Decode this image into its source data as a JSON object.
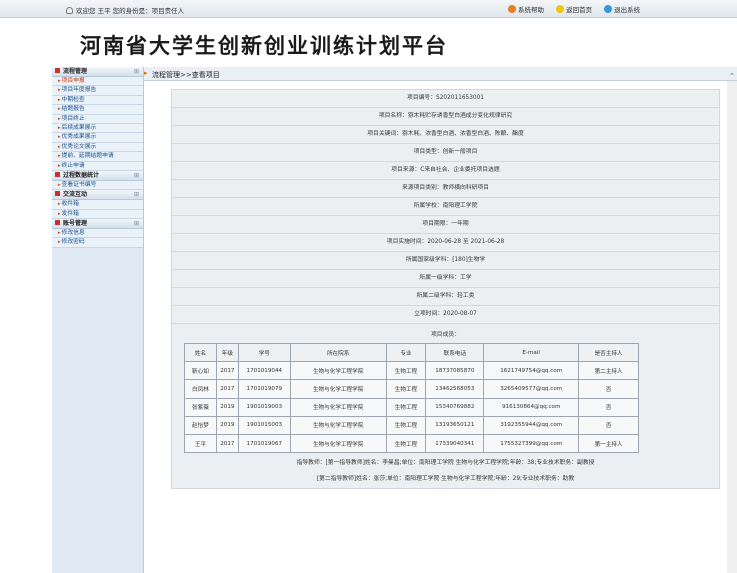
{
  "topbar": {
    "welcome": "欢迎您 王平 您的身份是：项目责任人",
    "links": [
      {
        "label": "系统帮助",
        "icon": "help-icon",
        "color": "#e67e22"
      },
      {
        "label": "返回首页",
        "icon": "home-icon",
        "color": "#f1c40f"
      },
      {
        "label": "退出系统",
        "icon": "logout-icon",
        "color": "#3498db"
      }
    ]
  },
  "banner": {
    "title": "河南省大学生创新创业训练计划平台"
  },
  "sidebar": {
    "groups": [
      {
        "title": "流程管理",
        "items": [
          "项目申报",
          "项目年度报告",
          "中期检查",
          "结题报告",
          "项目终止",
          "后续成果展示",
          "优秀成果展示",
          "优秀论文展示",
          "提前、延期结题申请",
          "终止申请"
        ]
      },
      {
        "title": "过程数据统计",
        "items": [
          "查看证书编号"
        ]
      },
      {
        "title": "交流互动",
        "items": [
          "收件箱",
          "发件箱"
        ]
      },
      {
        "title": "账号管理",
        "items": [
          "修改信息",
          "修改密码"
        ]
      }
    ]
  },
  "breadcrumb": "流程管理>>查看项目",
  "project": {
    "rows": [
      "项目编号：S202011653001",
      "项目名称：猕木耗贮存诱香型白酒成分变化规律研究",
      "项目关键词：猕木耗、浓香型白酒、浓香型白酒、陈酿、酯度",
      "项目类型：创新一般项目",
      "项目来源：C来自社会、企业委托项目选题",
      "来源项目类别：教师横向科研项目",
      "所属学校：南阳理工学院",
      "项目期限：一年期",
      "项目实施时间：2020-06-28 至 2021-06-28",
      "所属国家级学科：[180]生物学",
      "所属一级学科：工学",
      "所属二级学科：轻工类",
      "立项时间：2020-08-07"
    ],
    "members_title": "项目成员：",
    "member_headers": [
      "姓名",
      "年级",
      "学号",
      "所在院系",
      "专业",
      "联系电话",
      "E-mail",
      "是否主持人"
    ],
    "members": [
      [
        "靳心如",
        "2017",
        "1701019044",
        "生物与化学工程学院",
        "生物工程",
        "18737085870",
        "1621749754@qq.com",
        "第二主持人"
      ],
      [
        "白凤林",
        "2017",
        "1701019079",
        "生物与化学工程学院",
        "生物工程",
        "13462568053",
        "3265409577@qq.com",
        "否"
      ],
      [
        "张紫薇",
        "2019",
        "1901019003",
        "生物与化学工程学院",
        "生物工程",
        "15340769882",
        "916130864@qq.com",
        "否"
      ],
      [
        "赵怡梦",
        "2019",
        "1901015003",
        "生物与化学工程学院",
        "生物工程",
        "13193650121",
        "3192355944@qq.com",
        "否"
      ],
      [
        "王平",
        "2017",
        "1701019067",
        "生物与化学工程学院",
        "生物工程",
        "17339040341",
        "1755327399@qq.com",
        "第一主持人"
      ]
    ],
    "teacher1": "指导教师：[第一指导教师]姓名：李曼昌;单位：南阳理工学院 生物与化学工程学院;年龄：38;专业技术职务：副教授",
    "teacher2": "[第二指导教师]姓名：张莎;单位：南阳理工学院 生物与化学工程学院;年龄：29;专业技术职务：助教"
  }
}
